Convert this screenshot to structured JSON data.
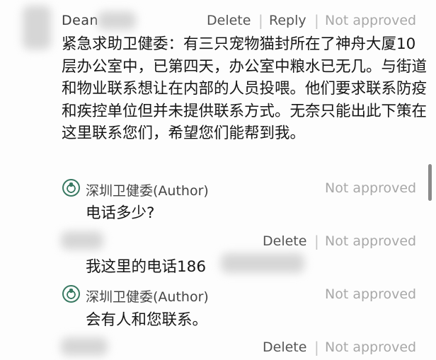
{
  "comment": {
    "author": "Dean",
    "actions": {
      "delete": "Delete",
      "reply": "Reply",
      "separator": "|",
      "status": "Not approved"
    },
    "text": "紧急求助卫健委：有三只宠物猫封所在了神舟大厦10层办公室中，已第四天，办公室中粮水已无几。与街道和物业联系想让在内部的人员投喂。他们要求联系防疫和疾控单位但并未提供联系方式。无奈只能出此下策在这里联系您们，希望您们能帮到我。"
  },
  "replies": [
    {
      "type": "author",
      "author": "深圳卫健委(Author)",
      "status": "Not approved",
      "text": "电话多少?"
    },
    {
      "type": "user",
      "delete": "Delete",
      "status": "Not approved",
      "text": "我这里的电话186"
    },
    {
      "type": "author",
      "author": "深圳卫健委(Author)",
      "status": "Not approved",
      "text": "会有人和您联系。"
    },
    {
      "type": "user",
      "delete": "Delete",
      "status": "Not approved",
      "text": ""
    }
  ]
}
